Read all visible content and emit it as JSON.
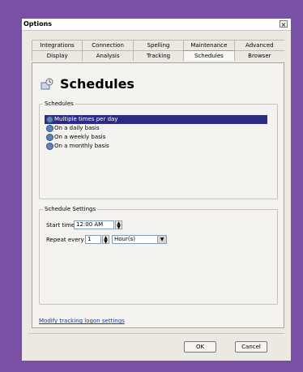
{
  "window": {
    "title": "Options"
  },
  "tabs_row1": [
    "Integrations",
    "Connection",
    "Spelling",
    "Maintenance",
    "Advanced"
  ],
  "tabs_row2": [
    "Display",
    "Analysis",
    "Tracking",
    "Schedules",
    "Browser"
  ],
  "selected_tab": "Schedules",
  "header": {
    "title": "Schedules",
    "icon": "schedule-icon"
  },
  "schedules_group": {
    "legend": "Schedules",
    "items": [
      "Multiple times per day",
      "On a daily basis",
      "On a weekly basis",
      "On a monthly basis"
    ],
    "selected": "Multiple times per day"
  },
  "settings_group": {
    "legend": "Schedule Settings",
    "start_label": "Start time:",
    "start_value": "12:00 AM",
    "repeat_label": "Repeat every",
    "repeat_value": "1",
    "repeat_unit": "Hour(s)"
  },
  "footer": {
    "link": "Modify tracking logon settings",
    "ok": "OK",
    "cancel": "Cancel"
  }
}
